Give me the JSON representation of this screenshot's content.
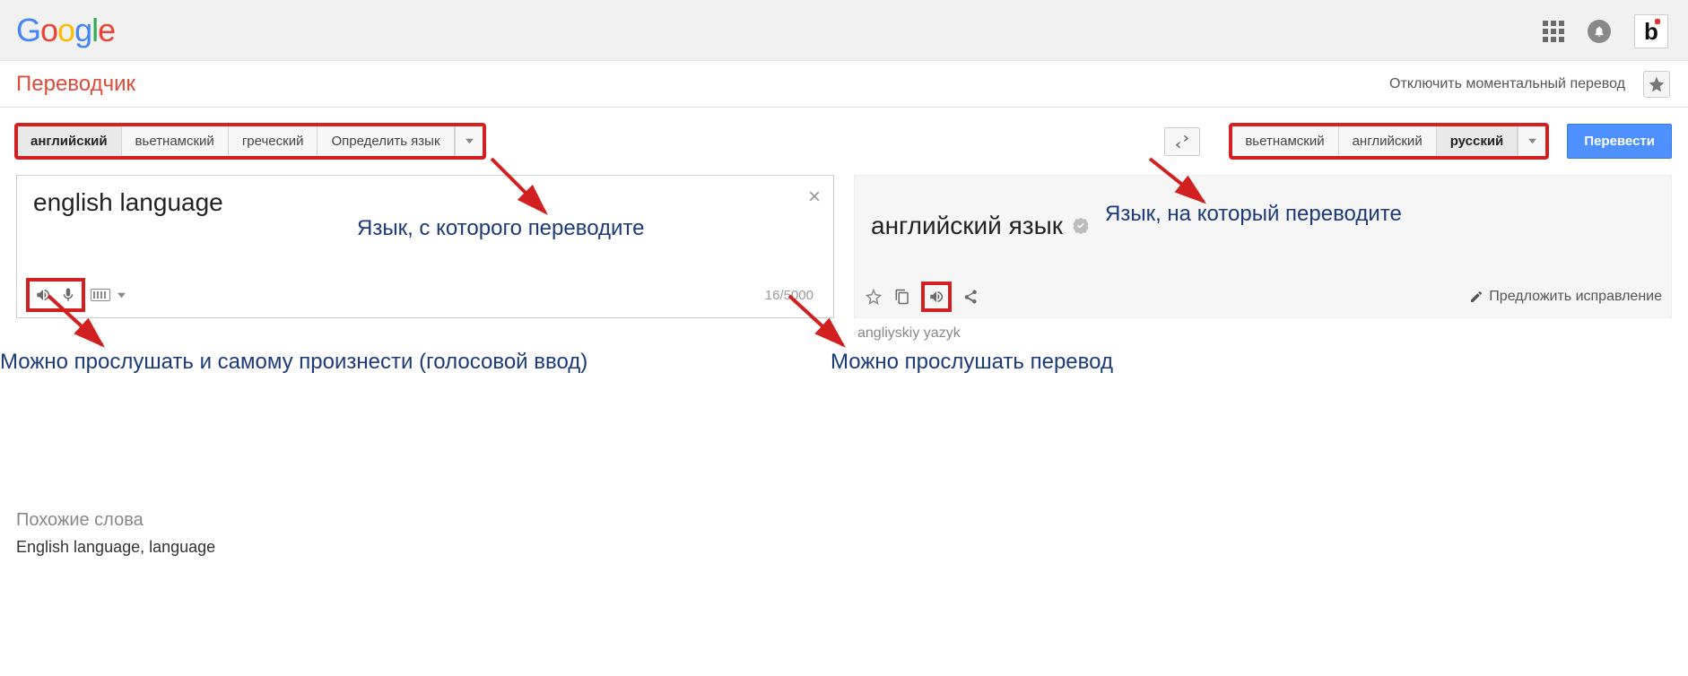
{
  "topbar": {
    "logo_letters": [
      "G",
      "o",
      "o",
      "g",
      "l",
      "e"
    ],
    "avatar_glyph": "b"
  },
  "subbar": {
    "app_title": "Переводчик",
    "instant_off": "Отключить моментальный перевод"
  },
  "source_langs": {
    "items": [
      {
        "label": "английский",
        "active": true
      },
      {
        "label": "вьетнамский",
        "active": false
      },
      {
        "label": "греческий",
        "active": false
      },
      {
        "label": "Определить язык",
        "active": false
      }
    ]
  },
  "target_langs": {
    "items": [
      {
        "label": "вьетнамский",
        "active": false
      },
      {
        "label": "английский",
        "active": false
      },
      {
        "label": "русский",
        "active": true
      }
    ]
  },
  "translate_button": "Перевести",
  "source": {
    "text": "english language",
    "char_count": "16/5000"
  },
  "target": {
    "text": "английский язык",
    "transliteration": "angliyskiy yazyk",
    "suggest_label": "Предложить исправление"
  },
  "annotations": {
    "src_lang": "Язык, с которого переводите",
    "dst_lang": "Язык, на который переводите",
    "src_listen": "Можно прослушать и самому произнести (голосовой ввод)",
    "dst_listen": "Можно прослушать перевод"
  },
  "related": {
    "heading": "Похожие слова",
    "words": "English language, language"
  }
}
